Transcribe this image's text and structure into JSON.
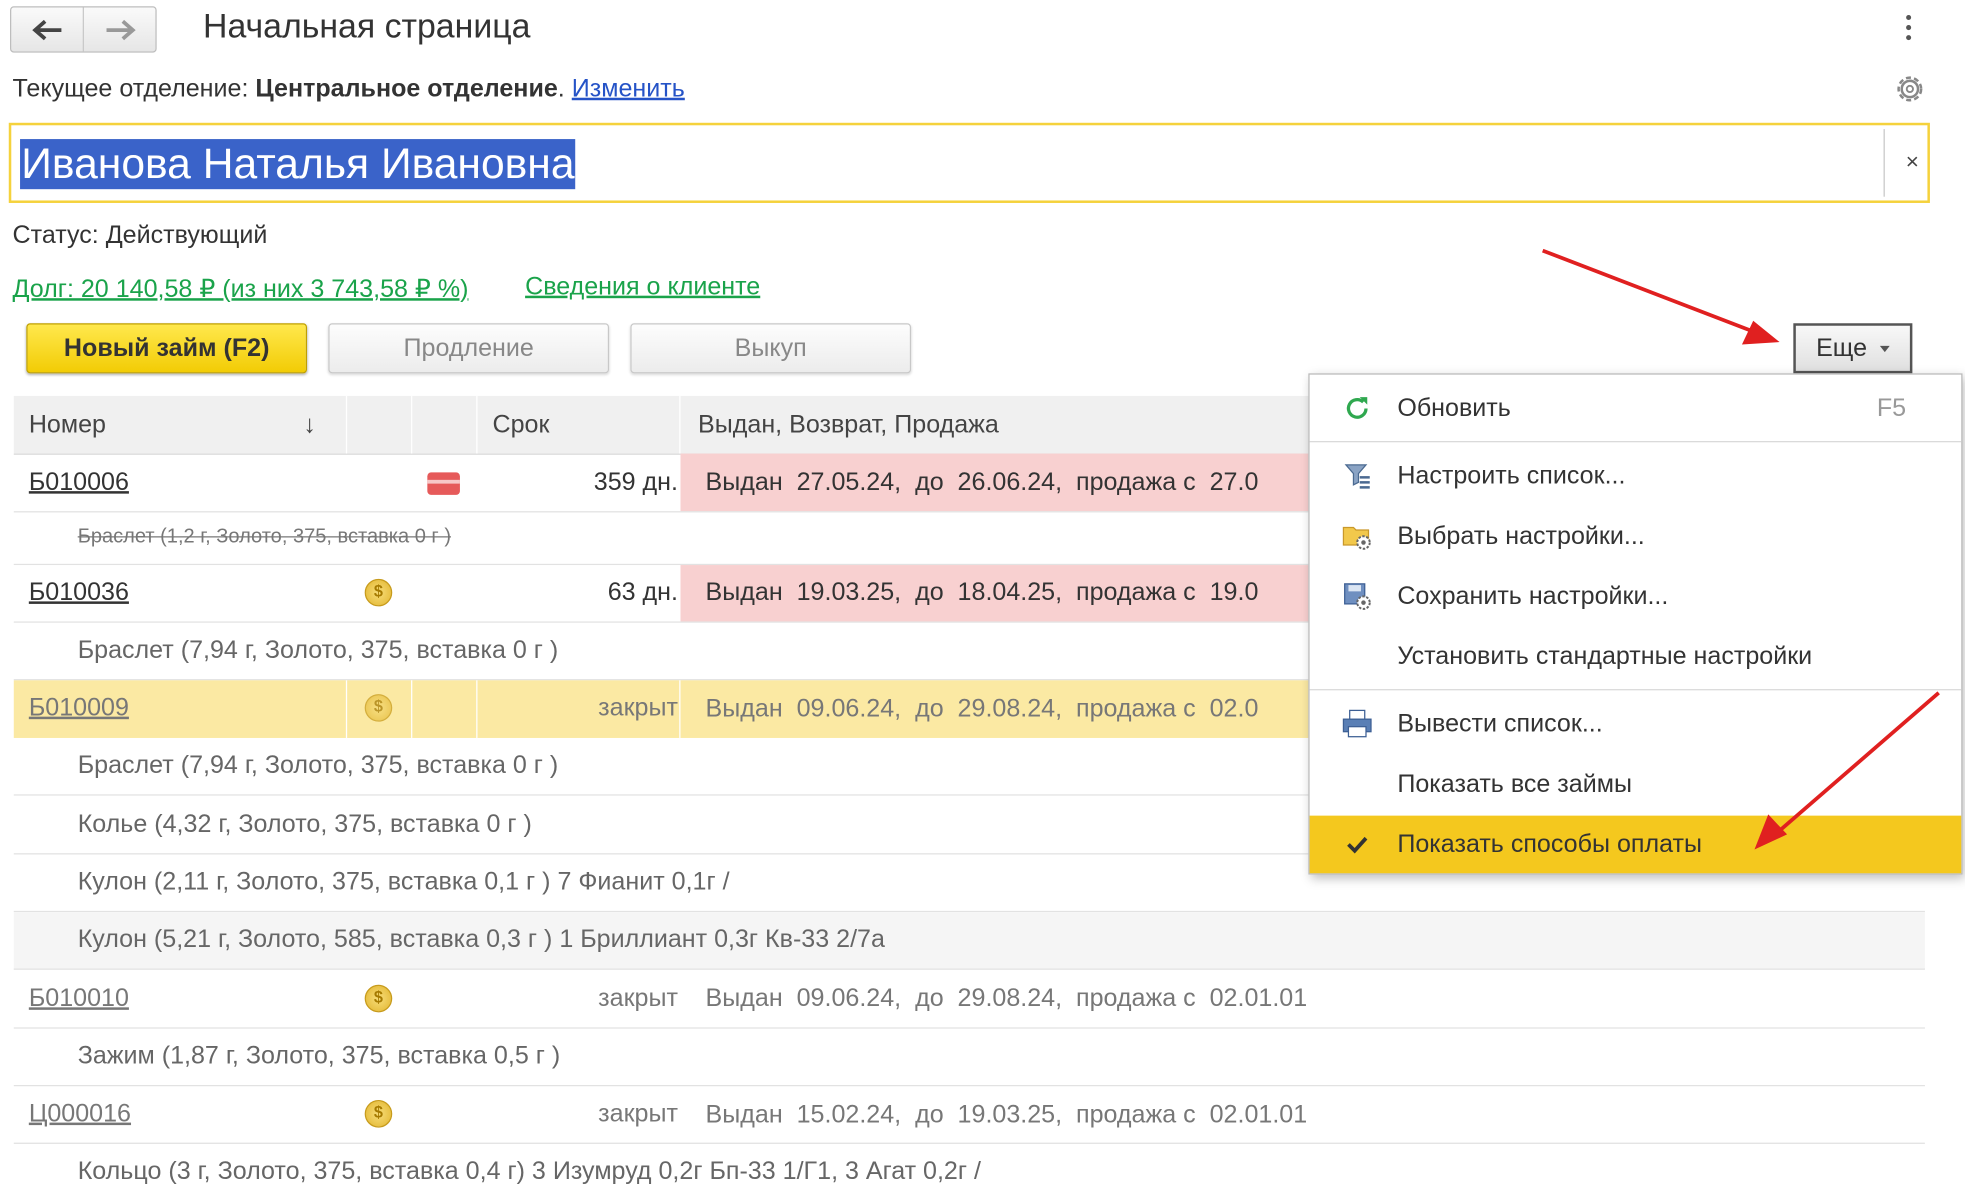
{
  "window": {
    "title": "Начальная страница"
  },
  "department": {
    "label": "Текущее отделение:",
    "name": "Центральное отделение",
    "suffix": ".",
    "change_link": "Изменить"
  },
  "client": {
    "name": "Иванова Наталья Ивановна",
    "clear": "×",
    "status": "Статус: Действующий",
    "debt": "Долг: 20 140,58 ₽ (из них 3 743,58 ₽ %)",
    "info_link": "Сведения о клиенте"
  },
  "toolbar": {
    "new_loan": "Новый займ (F2)",
    "extend": "Продление",
    "buyout": "Выкуп",
    "more": "Еще"
  },
  "table": {
    "headers": {
      "number": "Номер",
      "sort": "↓",
      "term": "Срок",
      "issued": "Выдан, Возврат, Продажа"
    },
    "rows": [
      {
        "number": "Б010006",
        "term": "359 дн.",
        "issued": "Выдан  27.05.24,  до  26.06.24,  продажа с  27.0",
        "items": [
          "Браслет (1,2 г, Золото, 375, вставка 0 г )"
        ]
      },
      {
        "number": "Б010036",
        "term": "63 дн.",
        "issued": "Выдан  19.03.25,  до  18.04.25,  продажа с  19.0",
        "items": [
          "Браслет (7,94 г, Золото, 375, вставка 0 г )"
        ]
      },
      {
        "number": "Б010009",
        "term": "закрыт",
        "issued": "Выдан  09.06.24,  до  29.08.24,  продажа с  02.0",
        "items": [
          "Браслет (7,94 г, Золото, 375, вставка 0 г )",
          "Колье (4,32 г, Золото, 375, вставка 0 г )",
          "Кулон (2,11 г, Золото, 375, вставка 0,1 г ) 7 Фианит 0,1г  /",
          "Кулон (5,21 г, Золото, 585, вставка 0,3 г ) 1 Бриллиант 0,3г Кв-33 2/7а"
        ]
      },
      {
        "number": "Б010010",
        "term": "закрыт",
        "issued": "Выдан  09.06.24,  до  29.08.24,  продажа с  02.01.01",
        "items": [
          "Зажим (1,87 г, Золото, 375, вставка 0,5 г )"
        ]
      },
      {
        "number": "Ц000016",
        "term": "закрыт",
        "issued": "Выдан  15.02.24,  до  19.03.25,  продажа с  02.01.01",
        "items": [
          "Кольцо (3 г, Золото, 375, вставка 0,4 г) 3 Изумруд 0,2г Бп-33 1/Г1, 3 Агат 0,2г  /"
        ]
      }
    ]
  },
  "menu": {
    "items": [
      {
        "label": "Обновить",
        "shortcut": "F5",
        "icon": "refresh-icon"
      },
      {
        "label": "Настроить список...",
        "icon": "list-settings-icon"
      },
      {
        "label": "Выбрать настройки...",
        "icon": "folder-settings-icon"
      },
      {
        "label": "Сохранить настройки...",
        "icon": "save-settings-icon"
      },
      {
        "label": "Установить стандартные настройки"
      },
      {
        "label": "Вывести список...",
        "icon": "print-list-icon"
      },
      {
        "label": "Показать все займы"
      },
      {
        "label": "Показать способы оплаты",
        "checked": true,
        "icon": "check-icon"
      }
    ]
  },
  "colors": {
    "accent_yellow": "#f4c81e",
    "overdue_red": "#f8d0d0",
    "link_blue": "#2553c7",
    "link_green": "#1aa34a",
    "selected_row": "#fbe9a3",
    "annotation_arrow": "#e02020"
  }
}
